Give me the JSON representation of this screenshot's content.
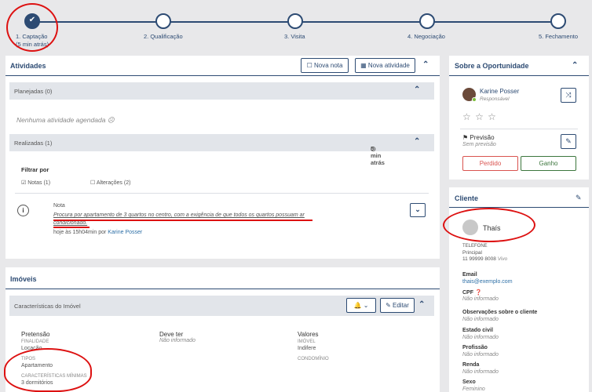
{
  "pipeline": {
    "steps": [
      {
        "label": "1. Captação",
        "sub": "(5 min atrás)"
      },
      {
        "label": "2. Qualificação"
      },
      {
        "label": "3. Visita"
      },
      {
        "label": "4. Negociação"
      },
      {
        "label": "5. Fechamento"
      }
    ]
  },
  "activities": {
    "title": "Atividades",
    "new_note": "Nova nota",
    "new_activity": "Nova atividade",
    "planned": "Planejadas (0)",
    "none_scheduled": "Nenhuma atividade agendada ☹",
    "done": "Realizadas (1)",
    "done_time": "5 min atrás",
    "filter_by": "Filtrar por",
    "filter_notes": "Notas (1)",
    "filter_changes": "Alterações (2)",
    "note_type": "Nota",
    "note_text_1": "Procura por apartamento de 3 quartos no centro, com a exigência de que todos os quartos possuam ar",
    "note_text_2": "condicionado.",
    "note_time": "hoje às 15h04min por",
    "note_author": "Karine Posser"
  },
  "properties": {
    "title": "Imóveis",
    "features_title": "Características do Imóvel",
    "edit": "Editar",
    "pretensao": "Pretensão",
    "finalidade_lbl": "FINALIDADE",
    "finalidade": "Locação",
    "tipos_lbl": "TIPOS",
    "tipos": "Apartamento",
    "caract_lbl": "CARACTERÍSTICAS MÍNIMAS",
    "caract": "3 dormitórios",
    "deve_ter": "Deve ter",
    "deve_ter_val": "Não informado",
    "valores": "Valores",
    "imovel_lbl": "IMÓVEL",
    "imovel_val": "Indifere",
    "condominio_lbl": "CONDOMÍNIO"
  },
  "about": {
    "title": "Sobre a Oportunidade",
    "owner": "Karine Posser",
    "owner_role": "Responsável",
    "stars": "☆ ☆ ☆",
    "forecast_lbl": "Previsão",
    "forecast_val": "Sem previsão",
    "lost": "Perdido",
    "won": "Ganho"
  },
  "client": {
    "title": "Cliente",
    "name": "Thaís",
    "phone_kind": "Telefone",
    "phone_main": "Principal",
    "phone": "11 99999 8008",
    "phone_carrier": "Vivo",
    "email_lbl": "Email",
    "email": "thais@exemplo.com",
    "cpf_lbl": "CPF",
    "cpf_val": "Não informado",
    "obs_lbl": "Observações sobre o cliente",
    "obs_val": "Não informado",
    "civil_lbl": "Estado civil",
    "civil_val": "Não informado",
    "prof_lbl": "Profissão",
    "prof_val": "Não informado",
    "renda_lbl": "Renda",
    "renda_val": "Não informado",
    "sexo_lbl": "Sexo",
    "sexo_val": "Feminino"
  },
  "colors": {
    "primary": "#2d4b73",
    "danger": "#d9534f",
    "success": "#3c763d",
    "annotation": "#dd1111"
  }
}
